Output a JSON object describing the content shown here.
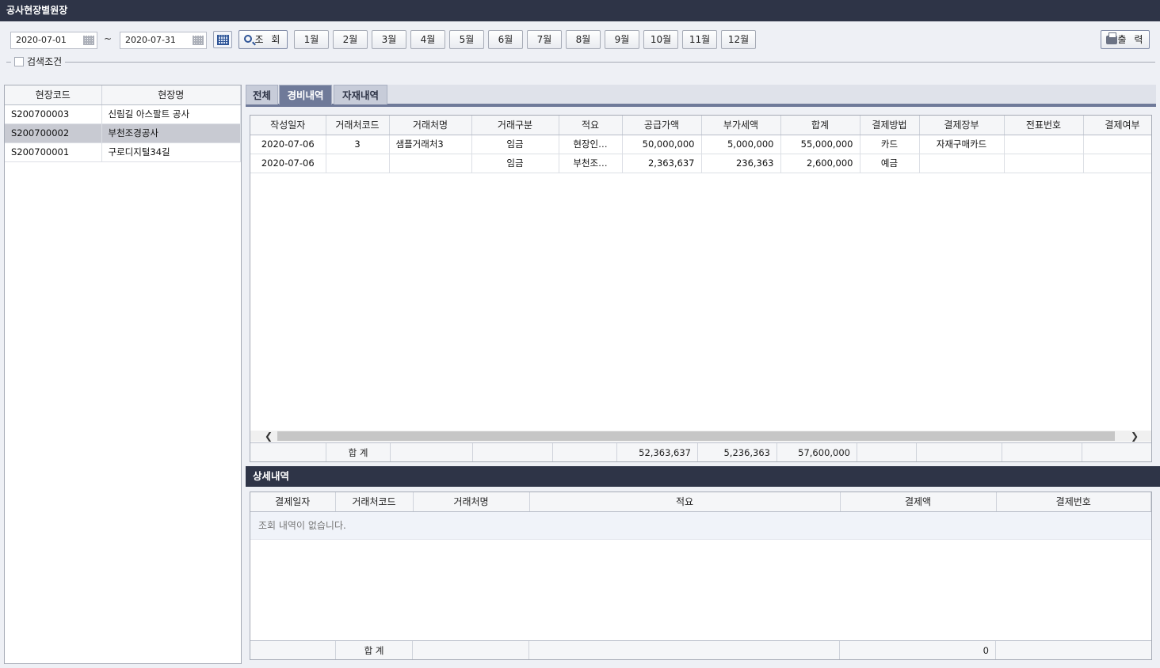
{
  "window": {
    "title": "공사현장별원장"
  },
  "toolbar": {
    "date_from": "2020-07-01",
    "date_to": "2020-07-31",
    "tilde": "~",
    "search_label": "조 회",
    "months": [
      "1월",
      "2월",
      "3월",
      "4월",
      "5월",
      "6월",
      "7월",
      "8월",
      "9월",
      "10월",
      "11월",
      "12월"
    ],
    "print_label": "출 력",
    "condition_label": "검색조건"
  },
  "sites": {
    "headers": [
      "현장코드",
      "현장명"
    ],
    "rows": [
      {
        "code": "S200700003",
        "name": "신림길 아스팔트 공사"
      },
      {
        "code": "S200700002",
        "name": "부천조경공사"
      },
      {
        "code": "S200700001",
        "name": "구로디지털34길"
      }
    ],
    "selected_index": 1
  },
  "tabs": {
    "items": [
      "전체",
      "경비내역",
      "자재내역"
    ],
    "active_index": 1
  },
  "ledger": {
    "headers": [
      "작성일자",
      "거래처코드",
      "거래처명",
      "거래구분",
      "적요",
      "공급가액",
      "부가세액",
      "합계",
      "결제방법",
      "결제장부",
      "전표번호",
      "결제여부"
    ],
    "rows": [
      [
        "2020-07-06",
        "3",
        "샘플거래처3",
        "임금",
        "현장인…",
        "50,000,000",
        "5,000,000",
        "55,000,000",
        "카드",
        "자재구매카드",
        "",
        ""
      ],
      [
        "2020-07-06",
        "",
        "",
        "임금",
        "부천조…",
        "2,363,637",
        "236,363",
        "2,600,000",
        "예금",
        "",
        "",
        ""
      ]
    ],
    "summary": {
      "label": "합 계",
      "supply": "52,363,637",
      "vat": "5,236,363",
      "total": "57,600,000"
    }
  },
  "detail": {
    "title": "상세내역",
    "headers": [
      "결제일자",
      "거래처코드",
      "거래처명",
      "적요",
      "결제액",
      "결제번호"
    ],
    "empty_message": "조회 내역이 없습니다.",
    "summary": {
      "label": "합 계",
      "amount": "0"
    }
  }
}
